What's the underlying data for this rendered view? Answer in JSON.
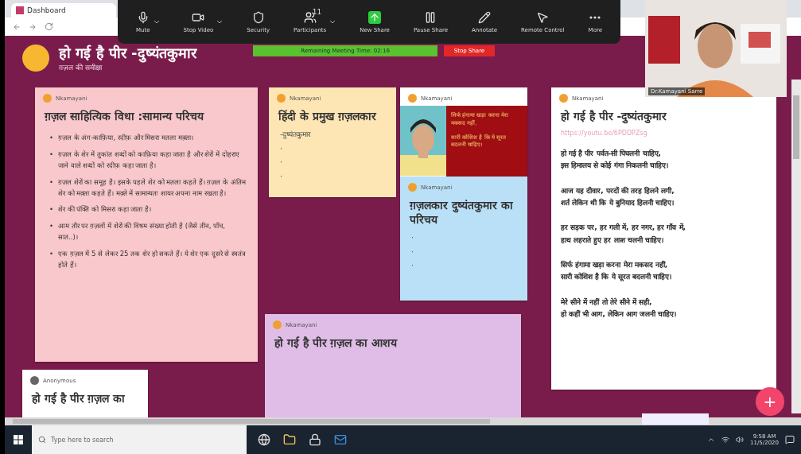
{
  "browser": {
    "tab_title": "Dashboard"
  },
  "meeting_toolbar": {
    "buttons": [
      {
        "kind": "mic",
        "label": "Mute",
        "caret": true
      },
      {
        "kind": "video",
        "label": "Stop Video",
        "caret": true
      },
      {
        "kind": "shield",
        "label": "Security",
        "caret": false
      },
      {
        "kind": "users",
        "label": "Participants",
        "badge": "11",
        "caret": true
      },
      {
        "kind": "share",
        "label": "New Share",
        "caret": false
      },
      {
        "kind": "pause",
        "label": "Pause Share",
        "caret": false
      },
      {
        "kind": "pen",
        "label": "Annotate",
        "caret": false
      },
      {
        "kind": "mouse",
        "label": "Remote Control",
        "caret": false
      },
      {
        "kind": "more",
        "label": "More",
        "caret": false
      }
    ],
    "timer": "Remaining Meeting Time: 02:16",
    "stop_share": "Stop Share"
  },
  "webcam": {
    "name": "Dr.Kamayani Sarre"
  },
  "board": {
    "title": "हो गई है पीर -दुष्यंतकुमार",
    "subtitle": "ग़ज़ल की समीक्षा"
  },
  "posts": [
    {
      "kind": "text",
      "author": "Nkamayani",
      "color": "#f9c8cc",
      "title": "ग़ज़ल साहित्यिक विधा :सामान्य परिचय",
      "marker": "•",
      "bullets": [
        "ग़ज़ल के अंग-काफ़िया, रदीफ़ और मिसरा मतला मक़्ता।",
        "ग़ज़ल के शेर में तुकांत शब्दों को काफ़िया कहा जाता है और शेरों में दोहराए जाने वाले शब्दों को रदीफ़ कहा जाता है।",
        "ग़ज़ल शेरों का समूह है। इसके पहले शेर को मतला कहते हैं। ग़ज़ल के अंतिम शेर को मक़्ता कहते हैं। मक़्ते में सामान्यतः शायर अपना नाम रखता है।",
        "शेर की पंक्ति को मिसरा कहा जाता है।",
        "आम तौर पर ग़ज़लों में शेरों की विषम संख्या होती है (जैसे तीन, पाँच, सात..)।",
        "एक ग़ज़ल में 5 से लेकर 25 तक शेर हो सकते हैं। ये शेर एक दूसरे से स्वतंत्र होते हैं।"
      ]
    },
    {
      "kind": "text",
      "author": "Nkamayani",
      "color": "#fde6b4",
      "title": "हिंदी के प्रमुख ग़ज़लकार",
      "lines": [
        "-दुष्यंतकुमार",
        "·",
        "·",
        "·"
      ]
    },
    {
      "author": "Nkamayani",
      "color": "#ffffff",
      "caption": [
        "सिर्फ हंगामा खड़ा करना मेरा मकसद नहीं,",
        "सारी कोशिश है कि ये सूरत बदलनी चाहिए।"
      ]
    },
    {
      "kind": "text",
      "author": "Nkamayani",
      "color": "#b9e0f7",
      "title": "ग़ज़लकार दुष्यंतकुमार का परिचय",
      "lines": [
        "·",
        "·",
        "·"
      ]
    },
    {
      "kind": "text",
      "author": "Nkamayani",
      "color": "#dfbde6",
      "title": "हो गई है पीर ग़ज़ल का आशय"
    },
    {
      "kind": "poem",
      "author": "Nkamayani",
      "color": "#ffffff",
      "title": "हो गई है पीर -दुष्यंतकुमार",
      "link": "https://youtu.be/6PDDPZsg",
      "stanzas": [
        [
          "हो गई है पीर पर्वत-सी पिघलनी चाहिए,",
          "इस हिमालय से कोई गंगा निकलनी चाहिए।"
        ],
        [
          "आज यह दीवार, परदों की तरह हिलने लगी,",
          "शर्त लेकिन थी कि ये बुनियाद हिलनी चाहिए।"
        ],
        [
          "हर सड़क पर, हर गली में, हर नगर, हर गाँव में,",
          "हाथ लहराते हुए हर लाश चलनी चाहिए।"
        ],
        [
          "सिर्फ हंगामा खड़ा करना मेरा मकसद नहीं,",
          "सारी कोशिश है कि ये सूरत बदलनी चाहिए।"
        ],
        [
          "मेरे सीने में नहीं तो तेरे सीने में सही,",
          "हो कहीं भी आग, लेकिन आग जलनी चाहिए।"
        ]
      ]
    },
    {
      "kind": "text",
      "author": "Anonymous",
      "color": "#ffffff",
      "title": "हो गई है पीर ग़ज़ल का"
    }
  ],
  "add_button": "+",
  "taskbar": {
    "search_placeholder": "Type here to search",
    "time": "9:58 AM",
    "date": "11/5/2020"
  }
}
